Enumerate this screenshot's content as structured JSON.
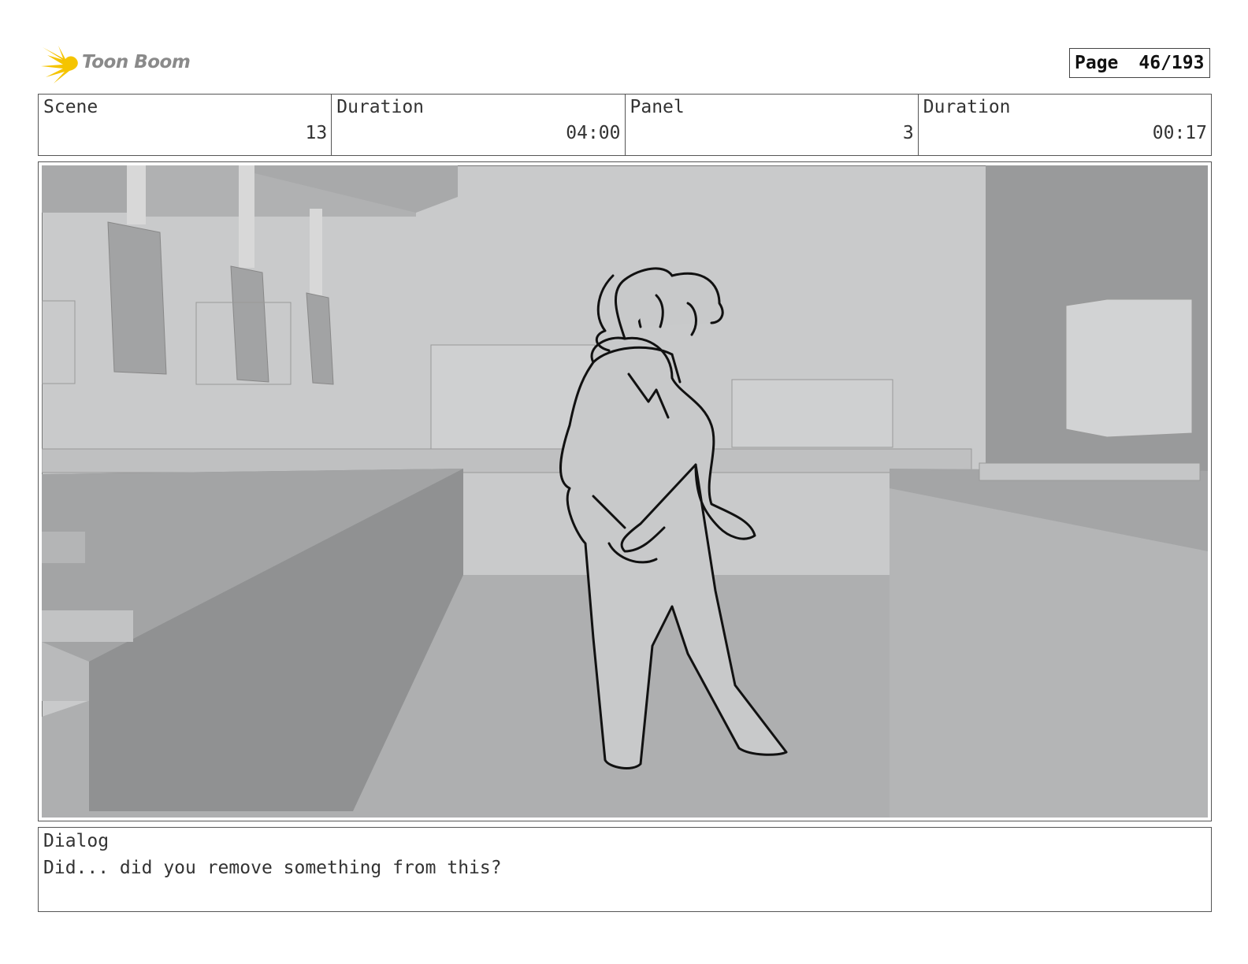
{
  "logo": {
    "text": "Toon Boom",
    "icon": "star-burst-icon",
    "color": "#f5c400"
  },
  "page": {
    "label": "Page",
    "value": "46/193"
  },
  "header": {
    "scene_label": "Scene",
    "scene_value": "13",
    "duration_label": "Duration",
    "duration_value": "04:00",
    "panel_label": "Panel",
    "panel_value": "3",
    "panel_duration_label": "Duration",
    "panel_duration_value": "00:17"
  },
  "dialog": {
    "label": "Dialog",
    "text": "Did... did you remove something from this?"
  }
}
